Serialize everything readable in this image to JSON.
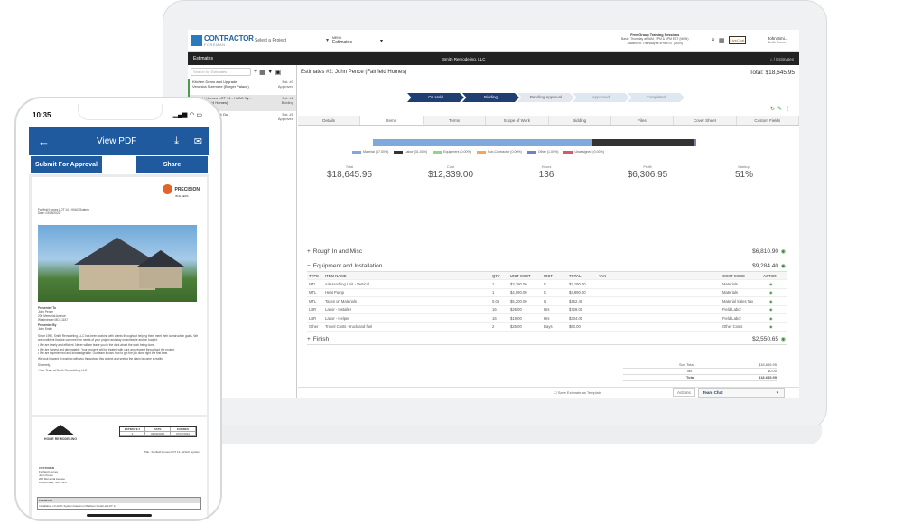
{
  "topbar": {
    "brand_main": "CONTRACTOR",
    "brand_sub": "FOREMAN",
    "select_project": "Select a Project",
    "menu_label": "MENU",
    "menu_value": "Estimates",
    "training_title": "Free Group Training Sessions",
    "training_basic": "Basic: Thursday at 9AM, 2PM & 6PM EST (MON)",
    "training_advanced": "Advanced: Thursday at 4PM EST (MON)",
    "livechat": "LiveChat",
    "user_name": "John Smi...",
    "user_sub": "Smith Remo..."
  },
  "darkbar": {
    "section": "Estimates",
    "company": "Smith Remodeling, LLC",
    "crumb": "Estimates"
  },
  "sidebar": {
    "search_placeholder": "Search for Estimates",
    "items": [
      {
        "title": "Kitchen Demo and Upgrade",
        "sub": "Veronica Sizemore (Burger Palace)",
        "num": "Est. #3",
        "status": "Approved"
      },
      {
        "title": "Fairfield Homes LOT 14 - HVAC Sy...",
        "sub": "...ce (Fairfield Homes)",
        "num": "Est. #2",
        "status": "Bidding"
      },
      {
        "title": "...ACE - Tenant Fit Out",
        "sub": "...coslo & Co.)",
        "num": "Est. #1",
        "status": "Approved"
      }
    ]
  },
  "main": {
    "title": "Estimates #2: John Pence (Fairfield Homes)",
    "total": "Total: $18,645.95",
    "stages": [
      "On Hold",
      "Bidding",
      "Pending Approval",
      "Approved",
      "Completed"
    ],
    "tabs": [
      "Details",
      "Items",
      "Terms",
      "Scope of Work",
      "Bidding",
      "Files",
      "Cover Sheet",
      "Custom Fields"
    ],
    "active_tab": "Items",
    "cost_bar": [
      {
        "label": "Material (67.00%)",
        "pct": 67,
        "color": "#7fa8dd"
      },
      {
        "label": "Labor (31.00%)",
        "pct": 31,
        "color": "#333333"
      },
      {
        "label": "Equipment (0.00%)",
        "pct": 0,
        "color": "#8fd48f"
      },
      {
        "label": "Sub-Contractor (0.00%)",
        "pct": 0,
        "color": "#f2a65a"
      },
      {
        "label": "Other (1.00%)",
        "pct": 1,
        "color": "#7b7bc8"
      },
      {
        "label": "Unassigned (0.00%)",
        "pct": 0,
        "color": "#d9566c"
      }
    ],
    "stats": [
      {
        "label": "Total",
        "value": "$18,645.95"
      },
      {
        "label": "Cost",
        "value": "$12,339.00"
      },
      {
        "label": "Hours",
        "value": "136"
      },
      {
        "label": "Profit",
        "value": "$6,306.95"
      },
      {
        "label": "Markup",
        "value": "51%"
      }
    ],
    "sections": [
      {
        "name": "Rough In and Misc",
        "amount": "$6,810.90",
        "toggle": "+"
      },
      {
        "name": "Equipment and Installation",
        "amount": "$9,284.40",
        "toggle": "−"
      },
      {
        "name": "Finish",
        "amount": "$2,550.65",
        "toggle": "+"
      }
    ],
    "table_headers": [
      "TYPE",
      "ITEM NAME",
      "QTY",
      "UNIT COST",
      "UNIT",
      "TOTAL",
      "TAX",
      "COST CODE",
      "ACTION"
    ],
    "rows": [
      {
        "type": "MTL",
        "name": "Air Handling Unit - Vertical",
        "qty": "1",
        "unit_cost": "$3,190.00",
        "unit": "Ic",
        "total": "$3,190.00",
        "code": "Materials"
      },
      {
        "type": "MTL",
        "name": "Heat Pump",
        "qty": "1",
        "unit_cost": "$4,890.00",
        "unit": "Ic",
        "total": "$4,890.00",
        "code": "Materials"
      },
      {
        "type": "MTL",
        "name": "Taxes on Materials",
        "qty": "0.06",
        "unit_cost": "$5,200.00",
        "unit": "Is",
        "total": "$452.40",
        "code": "Material Sales Tax"
      },
      {
        "type": "LBR",
        "name": "Labor - Installer",
        "qty": "16",
        "unit_cost": "$26.00",
        "unit": "Hrs",
        "total": "$728.00",
        "code": "Field Labor"
      },
      {
        "type": "LBR",
        "name": "Labor - Helper",
        "qty": "16",
        "unit_cost": "$19.00",
        "unit": "Hrs",
        "total": "$304.00",
        "code": "Field Labor"
      },
      {
        "type": "Other",
        "name": "Travel Costs - truck and fuel",
        "qty": "2",
        "unit_cost": "$25.00",
        "unit": "Days",
        "total": "$60.00",
        "code": "Other Costs"
      }
    ],
    "summary": [
      {
        "label": "Sub Total",
        "value": "$18,645.95"
      },
      {
        "label": "Tax",
        "value": "$0.00"
      },
      {
        "label": "Total",
        "value": "$18,645.95"
      }
    ],
    "save_template": "Save Estimate as Template",
    "actions": "Actions",
    "team_chat": "Team Chat"
  },
  "phone": {
    "time": "10:35",
    "title": "View PDF",
    "submit": "Submit For Approval",
    "share": "Share",
    "pdf_company_logo": "PRECISION",
    "pdf_logo_sub": "BUILDERS",
    "pdf_project": "Fairfield Homes LOT 14 - HVAC System",
    "pdf_date": "Date: 03/09/2022",
    "presented_to_label": "Presented To",
    "presented_to_name": "John Pence",
    "presented_to_addr1": "200 Memorial Avenue",
    "presented_to_addr2": "Westminster MD 21157",
    "presented_by_label": "Presented By",
    "presented_by_name": "John Smith",
    "intro": "Since 1990, Smith Remodeling, LLC has been working with clients throughout helping them meet their construction goals. We are confident that we can meet the needs of your project and stay on schedule and on budget.",
    "bullet1": "We are timely and efficient. Never will we leave you in the dark about the work being done.",
    "bullet2": "We are honest and dependable. Your property will be treated with care and respect throughout the project.",
    "bullet3": "We are experienced and knowledgeable. Our team knows how to get the job done right the first time.",
    "closing": "We look forward to working with you throughout this project and seeing the plans become a reality.",
    "sincerely": "Sincerely,",
    "signoff": "-Your Team at Smith Remodeling, LLC",
    "page2_logo": "HOME REMODELING",
    "est_headers": [
      "ESTIMATE #",
      "DATE",
      "EXPIRES"
    ],
    "est_values": [
      "2",
      "03/09/2022",
      "07/07/2022"
    ],
    "page2_title": "Title : Fairfield Homes LOT 14 - HVAC System",
    "customer_label": "CUSTOMER",
    "customer_lines": [
      "Fairfield Homes",
      "John Pence",
      "200 Memorial Avenue",
      "Westminster, MD 21157"
    ],
    "summary_label": "SUMMARY",
    "summary_text": "Installation of HVAC System based on Madison Model at LOT 14"
  }
}
